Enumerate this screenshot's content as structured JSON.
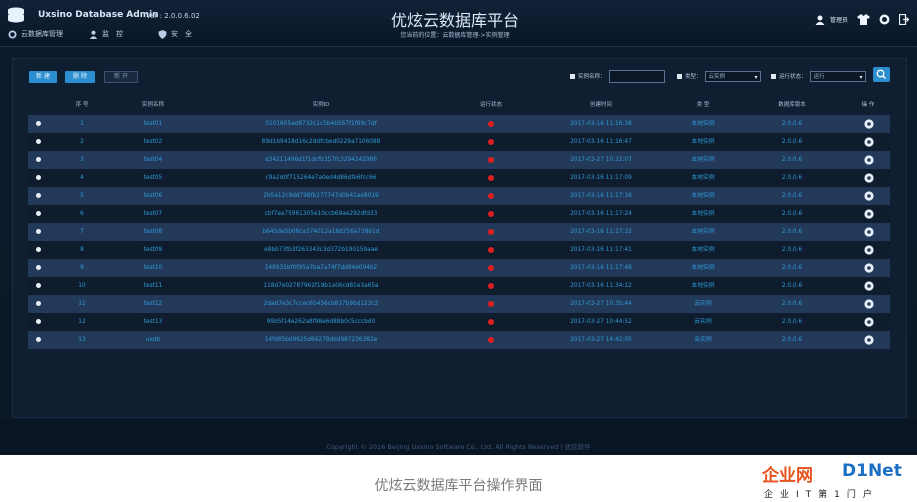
{
  "header": {
    "brand": "Uxsino Database Admin",
    "version": "Ver : 2.0.0.6.02",
    "title": "优炫云数据库平台",
    "location": "您当前的位置：云数据库管理->实例管理",
    "nav": [
      "云数据库管理",
      "监　控",
      "安　全"
    ],
    "user": "管理员"
  },
  "toolbar": {
    "new_label": "新 建",
    "delete_label": "删 除",
    "disconnect_label": "断 开",
    "filters": {
      "instance_name_label": "实例名称：",
      "instance_name_value": "",
      "type_label": "类型：",
      "type_value": "云实例",
      "status_label": "运行状态：",
      "status_value": "运行"
    }
  },
  "table": {
    "columns": [
      "序 号",
      "实例名称",
      "实例ID",
      "运行状态",
      "创建时间",
      "类 型",
      "数据库版本",
      "操 作"
    ],
    "rows": [
      {
        "no": "1",
        "name": "test01",
        "id": "0101605ad8732c1c5b4b567f1f69c7df",
        "time": "2017-03-16 11:16:38",
        "type": "本地实例",
        "ver": "2.0.0.6"
      },
      {
        "no": "2",
        "name": "test02",
        "id": "89d1b9418d16c2ddfcbed0229a7106088",
        "time": "2017-03-16 11:16:47",
        "type": "本地实例",
        "ver": "2.0.0.6"
      },
      {
        "no": "3",
        "name": "test04",
        "id": "d34211496d1f1dcfb357fc3294242986",
        "time": "2017-03-27 10:32:07",
        "type": "本地实例",
        "ver": "2.0.0.6"
      },
      {
        "no": "4",
        "name": "test05",
        "id": "c9a2d0f715264e7a0ed4d86dfe6fcc66",
        "time": "2017-03-16 11:17:09",
        "type": "本地实例",
        "ver": "2.0.0.6"
      },
      {
        "no": "5",
        "name": "test06",
        "id": "2b5a12c9dd798fb277747d0b41ae8019",
        "time": "2017-03-16 11:17:16",
        "type": "本地实例",
        "ver": "2.0.0.6"
      },
      {
        "no": "6",
        "name": "test07",
        "id": "cbf7ea75961305e10ccb69ae292dfd33",
        "time": "2017-03-16 11:17:24",
        "type": "本地实例",
        "ver": "2.0.0.6"
      },
      {
        "no": "7",
        "name": "test08",
        "id": "b645de5b08ca374012a18d256a73861d",
        "time": "2017-03-16 11:17:32",
        "type": "本地实例",
        "ver": "2.0.0.6"
      },
      {
        "no": "8",
        "name": "test09",
        "id": "e8bb73fb3f263343c3d372b190159aae",
        "time": "2017-03-16 11:17:41",
        "type": "本地实例",
        "ver": "2.0.0.6"
      },
      {
        "no": "9",
        "name": "test10",
        "id": "248931bf0f95a7ba7a74f7dd94e094b2",
        "time": "2017-03-16 11:17:48",
        "type": "本地实例",
        "ver": "2.0.0.6"
      },
      {
        "no": "10",
        "name": "test11",
        "id": "118d7e02787962f19b1a06cd81e3a65a",
        "time": "2017-03-16 11:34:12",
        "type": "本地实例",
        "ver": "2.0.0.6"
      },
      {
        "no": "11",
        "name": "test12",
        "id": "2dad7e3c7ccec65456cb837b9bd123c2",
        "time": "2017-03-27 10:35:44",
        "type": "云实例",
        "ver": "2.0.0.6"
      },
      {
        "no": "12",
        "name": "test13",
        "id": "99b5f14e262a8f98e6d88b0c5cccbd0",
        "time": "2017-03-27 10:44:52",
        "type": "云实例",
        "ver": "2.0.0.6"
      },
      {
        "no": "13",
        "name": "uxdb",
        "id": "14fd85bd9625d64278ddd987236382e",
        "time": "2017-03-27 14:42:05",
        "type": "云实例",
        "ver": "2.0.0.6"
      }
    ]
  },
  "footer": {
    "copyright": "Copyright © 2016 Beijing Uxsino Software Co., Ltd. All Rights Reserved | 优炫软件"
  },
  "caption": "优炫云数据库平台操作界面",
  "watermark": {
    "cn": "企业网",
    "en": "D1Net",
    "sub": "企业IT第1门户"
  },
  "colors": {
    "accent": "#2b8fcf",
    "status_running": "#e02020",
    "link": "#2e9cd9"
  }
}
